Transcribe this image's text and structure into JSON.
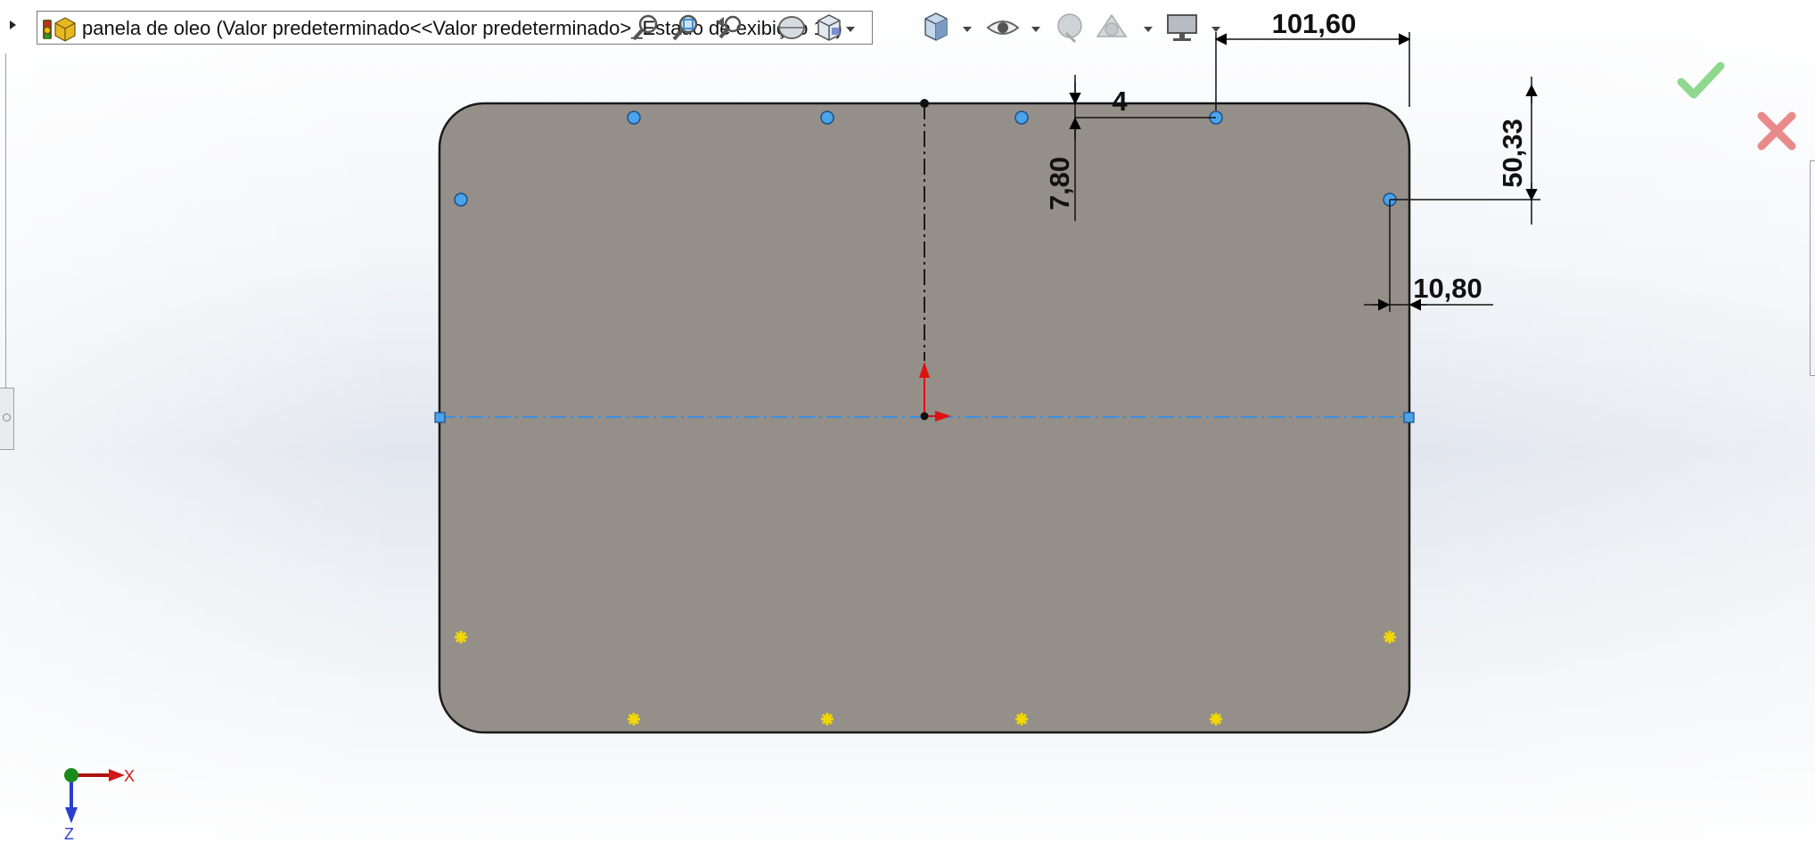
{
  "feature_tree": {
    "part_name": "panela de oleo  (Valor predeterminado<<Valor predeterminado>_Estado de exibição 1>)"
  },
  "dimensions": {
    "d1": "101,60",
    "d2": "4",
    "d3": "7,80",
    "d4": "50,33",
    "d5": "10,80"
  },
  "triad": {
    "x_label": "X",
    "z_label": "Z"
  },
  "heads_up_toolbar": {
    "icons": [
      "zoom-to-fit-icon",
      "zoom-area-icon",
      "previous-view-icon",
      "section-view-icon",
      "view-orientation-icon",
      "display-style-icon",
      "hide-show-items-icon",
      "edit-appearance-icon",
      "apply-scene-icon",
      "view-settings-icon"
    ]
  },
  "colors": {
    "sketch_face": "#958f89",
    "sketch_outline": "#1a1a1a",
    "selected_point": "#4ba3ea",
    "construction_line": "#3d8fe0",
    "fixed_point": "#ffe100",
    "confirm_green": "#7fd47f",
    "cancel_red": "#e98a8a",
    "origin_red": "#e01010",
    "triad_green": "#1a8a1a",
    "triad_blue": "#2a3fd1"
  }
}
